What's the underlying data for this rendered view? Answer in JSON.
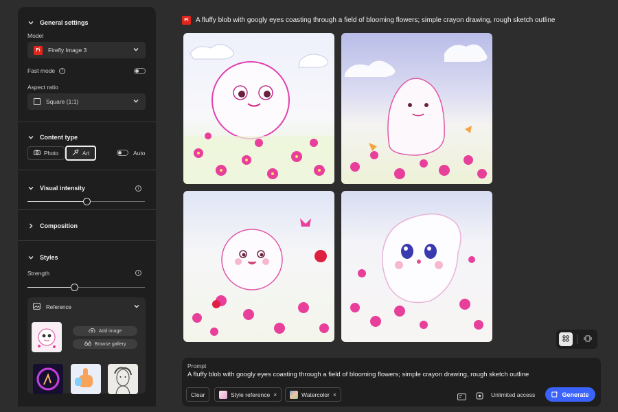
{
  "sidebar": {
    "general": {
      "title": "General settings",
      "model_label": "Model",
      "model_value": "Firefly Image 3",
      "model_badge": "Fi",
      "fast_mode_label": "Fast mode",
      "aspect_label": "Aspect ratio",
      "aspect_value": "Square (1:1)"
    },
    "content_type": {
      "title": "Content type",
      "photo_label": "Photo",
      "art_label": "Art",
      "auto_label": "Auto",
      "selected": "Art"
    },
    "visual_intensity": {
      "title": "Visual intensity",
      "value_fraction": 0.5
    },
    "composition": {
      "title": "Composition"
    },
    "styles": {
      "title": "Styles",
      "strength_label": "Strength",
      "strength_fraction": 0.4,
      "reference": {
        "title": "Reference",
        "add_image_label": "Add image",
        "browse_gallery_label": "Browse gallery"
      }
    }
  },
  "main": {
    "prompt_badge": "Fi",
    "prompt_title": "A fluffy blob with googly eyes coasting through a field of blooming flowers; simple crayon drawing, rough sketch outline"
  },
  "prompt_bar": {
    "label": "Prompt",
    "text": "A fluffy blob with googly eyes coasting through a field of blooming flowers; simple crayon drawing, rough sketch outline",
    "clear_label": "Clear",
    "chip_style_label": "Style reference",
    "chip_watercolor_label": "Watercolor",
    "chip_remove_glyph": "×",
    "unlimited_label": "Unlimited access",
    "generate_label": "Generate"
  },
  "colors": {
    "accent": "#3b63fb",
    "brand": "#e1251b",
    "sidebar_bg": "#1e1e1e",
    "page_bg": "#2d2d2d"
  }
}
